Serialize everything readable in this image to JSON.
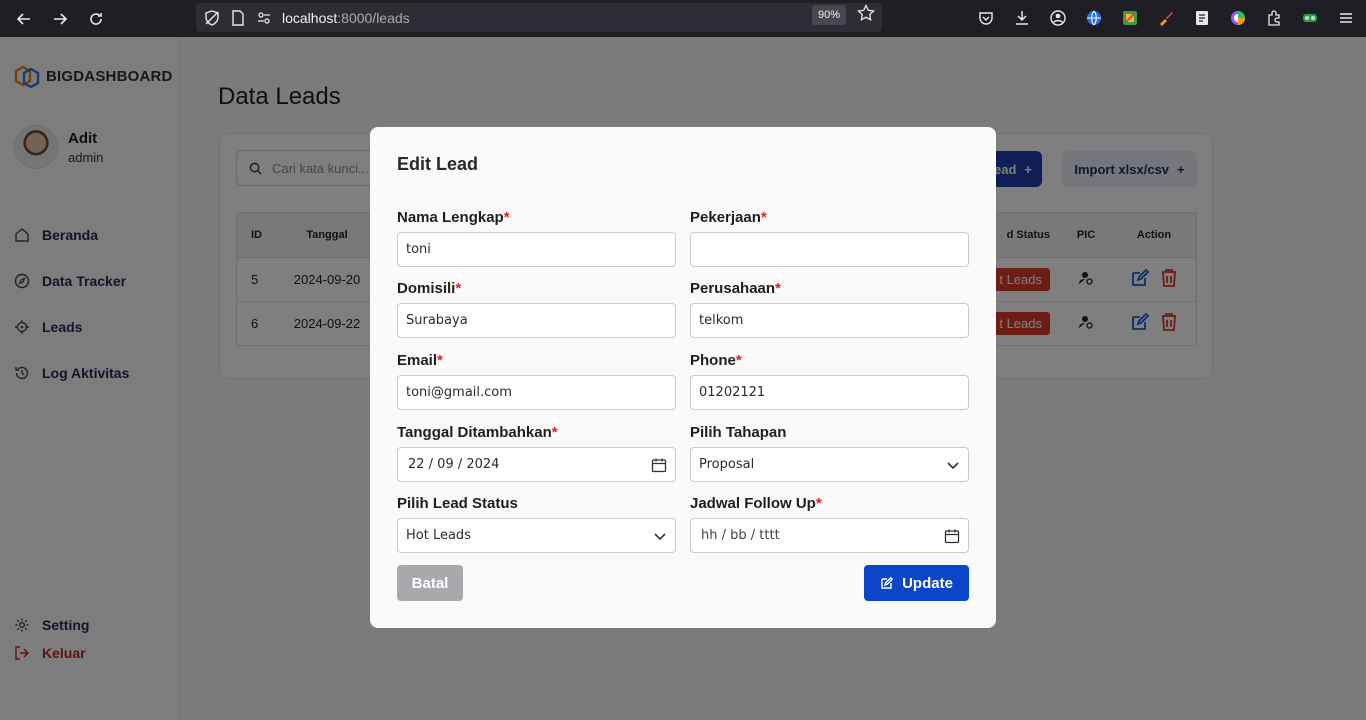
{
  "browser": {
    "url_host": "localhost",
    "url_port_path": ":8000/leads",
    "zoom": "90%"
  },
  "sidebar": {
    "brand": "BIGDASHBOARD",
    "user_name": "Adit",
    "user_role": "admin",
    "items": [
      {
        "label": "Beranda",
        "icon": "home-icon"
      },
      {
        "label": "Data Tracker",
        "icon": "compass-icon"
      },
      {
        "label": "Leads",
        "icon": "target-icon"
      },
      {
        "label": "Log Aktivitas",
        "icon": "history-icon"
      }
    ],
    "setting_label": "Setting",
    "logout_label": "Keluar"
  },
  "page": {
    "title": "Data Leads",
    "search_placeholder": "Cari kata kunci...",
    "add_button_label": "ead",
    "import_button_label": "Import xlsx/csv",
    "table": {
      "headers": {
        "id": "ID",
        "tanggal": "Tanggal",
        "status": "d Status",
        "pic": "PIC",
        "action": "Action"
      },
      "rows": [
        {
          "id": "5",
          "tanggal": "2024-09-20",
          "status": "t Leads"
        },
        {
          "id": "6",
          "tanggal": "2024-09-22",
          "status": "t Leads"
        }
      ]
    }
  },
  "modal": {
    "title": "Edit Lead",
    "fields": {
      "nama": {
        "label": "Nama Lengkap",
        "value": "toni"
      },
      "pekerjaan": {
        "label": "Pekerjaan",
        "value": ""
      },
      "domisili": {
        "label": "Domisili",
        "value": "Surabaya"
      },
      "perusahaan": {
        "label": "Perusahaan",
        "value": "telkom"
      },
      "email": {
        "label": "Email",
        "value": "toni@gmail.com"
      },
      "phone": {
        "label": "Phone",
        "value": "01202121"
      },
      "tanggal": {
        "label": "Tanggal Ditambahkan",
        "value": "22 / 09 / 2024"
      },
      "tahapan": {
        "label": "Pilih Tahapan",
        "value": "Proposal"
      },
      "lead_status": {
        "label": "Pilih Lead Status",
        "value": "Hot Leads"
      },
      "follow_up": {
        "label": "Jadwal Follow Up",
        "value": "hh / bb / tttt"
      }
    },
    "required_mark": "*",
    "cancel_label": "Batal",
    "update_label": "Update"
  },
  "colors": {
    "primary": "#0b45c8",
    "danger": "#d93a2b",
    "cancel": "#a9a9ad"
  }
}
